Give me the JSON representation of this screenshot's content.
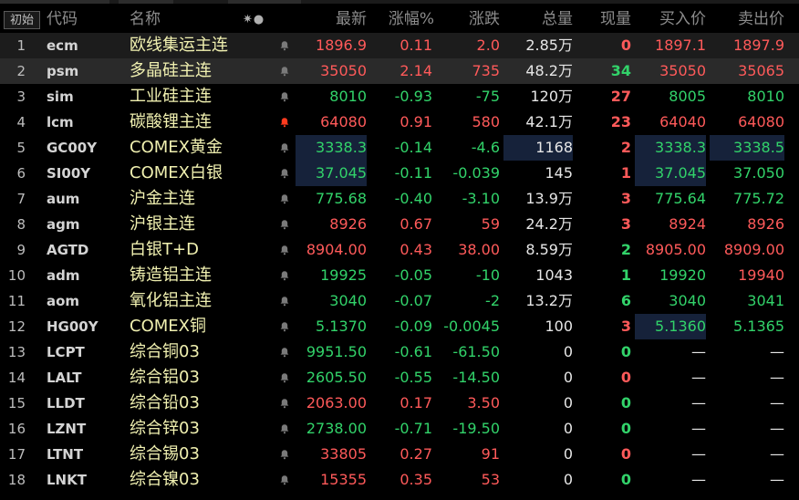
{
  "toolbar": {
    "init_label": "初始"
  },
  "columns": {
    "code": "代码",
    "name": "名称",
    "options": "✷●",
    "price": "最新",
    "pct": "涨幅%",
    "chg": "涨跌",
    "vol": "总量",
    "cur": "现量",
    "bid": "买入价",
    "ask": "卖出价"
  },
  "colors": {
    "up": "#ff5a5a",
    "down": "#32d36a",
    "neutral": "#e6e6e6",
    "name": "#f0f0b0",
    "bell_alert": "#ff3b1e"
  },
  "rows": [
    {
      "n": "1",
      "code": "ecm",
      "name": "欧线集运主连",
      "bell": "gray",
      "price": "1896.9",
      "pct": "0.11",
      "chg": "2.0",
      "vol": "2.85万",
      "cur": "0",
      "bid": "1897.1",
      "ask": "1897.9",
      "dir": "red",
      "curdir": "red",
      "biddir": "red",
      "askdir": "red"
    },
    {
      "n": "2",
      "code": "psm",
      "name": "多晶硅主连",
      "bell": "gray",
      "price": "35050",
      "pct": "2.14",
      "chg": "735",
      "vol": "48.2万",
      "cur": "34",
      "bid": "35050",
      "ask": "35065",
      "dir": "red",
      "curdir": "green",
      "biddir": "red",
      "askdir": "red"
    },
    {
      "n": "3",
      "code": "sim",
      "name": "工业硅主连",
      "bell": "gray",
      "price": "8010",
      "pct": "-0.93",
      "chg": "-75",
      "vol": "120万",
      "cur": "27",
      "bid": "8005",
      "ask": "8010",
      "dir": "green",
      "curdir": "red",
      "biddir": "green",
      "askdir": "green"
    },
    {
      "n": "4",
      "code": "lcm",
      "name": "碳酸锂主连",
      "bell": "red",
      "price": "64080",
      "pct": "0.91",
      "chg": "580",
      "vol": "42.1万",
      "cur": "23",
      "bid": "64040",
      "ask": "64080",
      "dir": "red",
      "curdir": "red",
      "biddir": "red",
      "askdir": "red"
    },
    {
      "n": "5",
      "code": "GC00Y",
      "name": "COMEX黄金",
      "bell": "gray",
      "price": "3338.3",
      "pct": "-0.14",
      "chg": "-4.6",
      "vol": "1168",
      "cur": "2",
      "bid": "3338.3",
      "ask": "3338.5",
      "dir": "green",
      "curdir": "red",
      "biddir": "green",
      "askdir": "green"
    },
    {
      "n": "6",
      "code": "SI00Y",
      "name": "COMEX白银",
      "bell": "gray",
      "price": "37.045",
      "pct": "-0.11",
      "chg": "-0.039",
      "vol": "145",
      "cur": "1",
      "bid": "37.045",
      "ask": "37.050",
      "dir": "green",
      "curdir": "red",
      "biddir": "green",
      "askdir": "green"
    },
    {
      "n": "7",
      "code": "aum",
      "name": "沪金主连",
      "bell": "gray",
      "price": "775.68",
      "pct": "-0.40",
      "chg": "-3.10",
      "vol": "13.9万",
      "cur": "3",
      "bid": "775.64",
      "ask": "775.72",
      "dir": "green",
      "curdir": "red",
      "biddir": "green",
      "askdir": "green"
    },
    {
      "n": "8",
      "code": "agm",
      "name": "沪银主连",
      "bell": "gray",
      "price": "8926",
      "pct": "0.67",
      "chg": "59",
      "vol": "24.2万",
      "cur": "3",
      "bid": "8924",
      "ask": "8926",
      "dir": "red",
      "curdir": "red",
      "biddir": "red",
      "askdir": "red"
    },
    {
      "n": "9",
      "code": "AGTD",
      "name": "白银T+D",
      "bell": "gray",
      "price": "8904.00",
      "pct": "0.43",
      "chg": "38.00",
      "vol": "8.59万",
      "cur": "2",
      "bid": "8905.00",
      "ask": "8909.00",
      "dir": "red",
      "curdir": "green",
      "biddir": "red",
      "askdir": "red"
    },
    {
      "n": "10",
      "code": "adm",
      "name": "铸造铝主连",
      "bell": "gray",
      "price": "19925",
      "pct": "-0.05",
      "chg": "-10",
      "vol": "1043",
      "cur": "1",
      "bid": "19920",
      "ask": "19940",
      "dir": "green",
      "curdir": "green",
      "biddir": "green",
      "askdir": "red"
    },
    {
      "n": "11",
      "code": "aom",
      "name": "氧化铝主连",
      "bell": "gray",
      "price": "3040",
      "pct": "-0.07",
      "chg": "-2",
      "vol": "13.2万",
      "cur": "6",
      "bid": "3040",
      "ask": "3041",
      "dir": "green",
      "curdir": "green",
      "biddir": "green",
      "askdir": "green"
    },
    {
      "n": "12",
      "code": "HG00Y",
      "name": "COMEX铜",
      "bell": "gray",
      "price": "5.1370",
      "pct": "-0.09",
      "chg": "-0.0045",
      "vol": "100",
      "cur": "3",
      "bid": "5.1360",
      "ask": "5.1365",
      "dir": "green",
      "curdir": "red",
      "biddir": "green",
      "askdir": "green"
    },
    {
      "n": "13",
      "code": "LCPT",
      "name": "综合铜03",
      "bell": "gray",
      "price": "9951.50",
      "pct": "-0.61",
      "chg": "-61.50",
      "vol": "0",
      "cur": "0",
      "bid": "—",
      "ask": "—",
      "dir": "green",
      "curdir": "green",
      "biddir": "dash",
      "askdir": "dash"
    },
    {
      "n": "14",
      "code": "LALT",
      "name": "综合铝03",
      "bell": "gray",
      "price": "2605.50",
      "pct": "-0.55",
      "chg": "-14.50",
      "vol": "0",
      "cur": "0",
      "bid": "—",
      "ask": "—",
      "dir": "green",
      "curdir": "red",
      "biddir": "dash",
      "askdir": "dash"
    },
    {
      "n": "15",
      "code": "LLDT",
      "name": "综合铅03",
      "bell": "gray",
      "price": "2063.00",
      "pct": "0.17",
      "chg": "3.50",
      "vol": "0",
      "cur": "0",
      "bid": "—",
      "ask": "—",
      "dir": "red",
      "curdir": "green",
      "biddir": "dash",
      "askdir": "dash"
    },
    {
      "n": "16",
      "code": "LZNT",
      "name": "综合锌03",
      "bell": "gray",
      "price": "2738.00",
      "pct": "-0.71",
      "chg": "-19.50",
      "vol": "0",
      "cur": "0",
      "bid": "—",
      "ask": "—",
      "dir": "green",
      "curdir": "green",
      "biddir": "dash",
      "askdir": "dash"
    },
    {
      "n": "17",
      "code": "LTNT",
      "name": "综合锡03",
      "bell": "gray",
      "price": "33805",
      "pct": "0.27",
      "chg": "91",
      "vol": "0",
      "cur": "0",
      "bid": "—",
      "ask": "—",
      "dir": "red",
      "curdir": "red",
      "biddir": "dash",
      "askdir": "dash"
    },
    {
      "n": "18",
      "code": "LNKT",
      "name": "综合镍03",
      "bell": "gray",
      "price": "15355",
      "pct": "0.35",
      "chg": "53",
      "vol": "0",
      "cur": "0",
      "bid": "—",
      "ask": "—",
      "dir": "red",
      "curdir": "green",
      "biddir": "dash",
      "askdir": "dash"
    }
  ]
}
